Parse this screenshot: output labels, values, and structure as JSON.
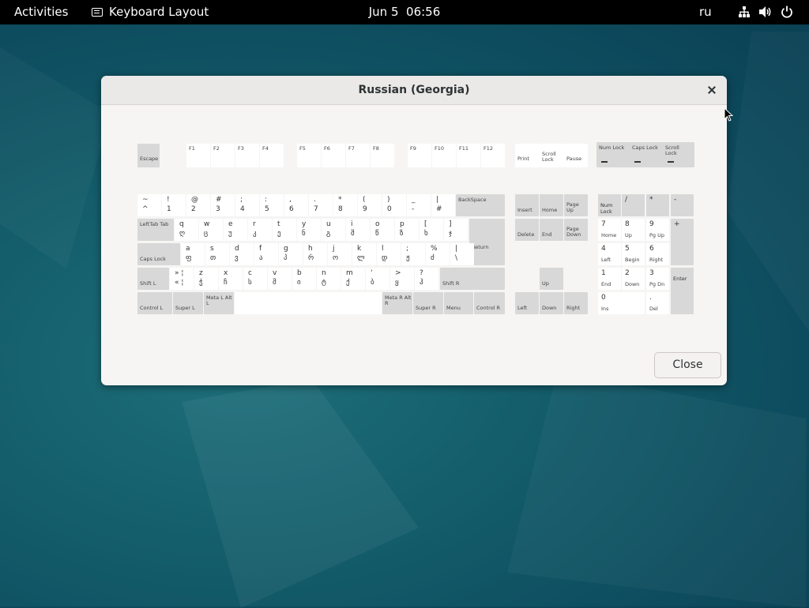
{
  "topbar": {
    "activities": "Activities",
    "app_name": "Keyboard Layout",
    "date": "Jun 5",
    "time": "06:56",
    "input_source": "ru"
  },
  "dialog": {
    "title": "Russian (Georgia)",
    "close_label": "Close"
  },
  "keyboard": {
    "function_row": [
      "Escape",
      "F1",
      "F2",
      "F3",
      "F4",
      "F5",
      "F6",
      "F7",
      "F8",
      "F9",
      "F10",
      "F11",
      "F12",
      "Print",
      "Scroll Lock",
      "Pause"
    ],
    "leds": [
      "Num Lock",
      "Caps Lock",
      "Scroll Lock"
    ],
    "number_row": [
      {
        "top": "~",
        "bottom": "^"
      },
      {
        "top": "!",
        "bottom": "1"
      },
      {
        "top": "@",
        "bottom": "2"
      },
      {
        "top": "#",
        "bottom": "3"
      },
      {
        "top": ";",
        "bottom": "4"
      },
      {
        "top": ":",
        "bottom": "5"
      },
      {
        "top": ",",
        "bottom": "6"
      },
      {
        "top": ".",
        "bottom": "7"
      },
      {
        "top": "*",
        "bottom": "8"
      },
      {
        "top": "(",
        "bottom": "9"
      },
      {
        "top": ")",
        "bottom": "0"
      },
      {
        "top": "_",
        "bottom": "-"
      },
      {
        "top": "|",
        "bottom": "#"
      }
    ],
    "backspace": "BackSpace",
    "tab_label": "LeftTab Tab",
    "qwerty_row": [
      {
        "top": "q",
        "bottom": "ღ"
      },
      {
        "top": "w",
        "bottom": "ც"
      },
      {
        "top": "e",
        "bottom": "უ"
      },
      {
        "top": "r",
        "bottom": "კ"
      },
      {
        "top": "t",
        "bottom": "ე"
      },
      {
        "top": "y",
        "bottom": "ნ"
      },
      {
        "top": "u",
        "bottom": "გ"
      },
      {
        "top": "i",
        "bottom": "შ"
      },
      {
        "top": "o",
        "bottom": "წ"
      },
      {
        "top": "p",
        "bottom": "ზ"
      },
      {
        "top": "[",
        "bottom": "ხ"
      },
      {
        "top": "]",
        "bottom": "ჯ"
      }
    ],
    "return": "Return",
    "capslock": "Caps Lock",
    "home_row": [
      {
        "top": "a",
        "bottom": "ფ"
      },
      {
        "top": "s",
        "bottom": "თ"
      },
      {
        "top": "d",
        "bottom": "ვ"
      },
      {
        "top": "f",
        "bottom": "ა"
      },
      {
        "top": "g",
        "bottom": "პ"
      },
      {
        "top": "h",
        "bottom": "რ"
      },
      {
        "top": "j",
        "bottom": "ო"
      },
      {
        "top": "k",
        "bottom": "ლ"
      },
      {
        "top": "l",
        "bottom": "დ"
      },
      {
        "top": ";",
        "bottom": "ჟ"
      },
      {
        "top": "%",
        "bottom": "ძ"
      },
      {
        "top": "|",
        "bottom": "\\"
      }
    ],
    "shift_l": "Shift L",
    "bottom_row": [
      {
        "top": "» ¦",
        "bottom": "« ¦"
      },
      {
        "top": "z",
        "bottom": "ჭ"
      },
      {
        "top": "x",
        "bottom": "ჩ"
      },
      {
        "top": "c",
        "bottom": "ს"
      },
      {
        "top": "v",
        "bottom": "მ"
      },
      {
        "top": "b",
        "bottom": "ი"
      },
      {
        "top": "n",
        "bottom": "ტ"
      },
      {
        "top": "m",
        "bottom": "ქ"
      },
      {
        "top": "‘",
        "bottom": "ბ"
      },
      {
        "top": ">",
        "bottom": "ყ"
      },
      {
        "top": "?",
        "bottom": "ჰ"
      }
    ],
    "shift_r": "Shift R",
    "control_l": "Control L",
    "super_l": "Super L",
    "alt_l": "Meta L Alt L",
    "alt_r": "Meta R Alt R",
    "super_r": "Super R",
    "menu": "Menu",
    "control_r": "Control R",
    "nav": [
      "Insert",
      "Home",
      "Page Up",
      "Delete",
      "End",
      "Page Down"
    ],
    "arrows": [
      "Up",
      "Left",
      "Down",
      "Right"
    ],
    "numpad": [
      {
        "top": "Num Lock",
        "bottom": ""
      },
      {
        "top": "/",
        "bottom": ""
      },
      {
        "top": "*",
        "bottom": ""
      },
      {
        "top": "-",
        "bottom": ""
      },
      {
        "top": "7",
        "bottom": "Home"
      },
      {
        "top": "8",
        "bottom": "Up"
      },
      {
        "top": "9",
        "bottom": "Pg Up"
      },
      {
        "top": "+",
        "bottom": ""
      },
      {
        "top": "4",
        "bottom": "Left"
      },
      {
        "top": "5",
        "bottom": "Begin"
      },
      {
        "top": "6",
        "bottom": "Right"
      },
      {
        "top": "1",
        "bottom": "End"
      },
      {
        "top": "2",
        "bottom": "Down"
      },
      {
        "top": "3",
        "bottom": "Pg Dn"
      },
      {
        "top": "Enter",
        "bottom": ""
      },
      {
        "top": "0",
        "bottom": "Ins"
      },
      {
        "top": ".",
        "bottom": "Del"
      }
    ]
  }
}
